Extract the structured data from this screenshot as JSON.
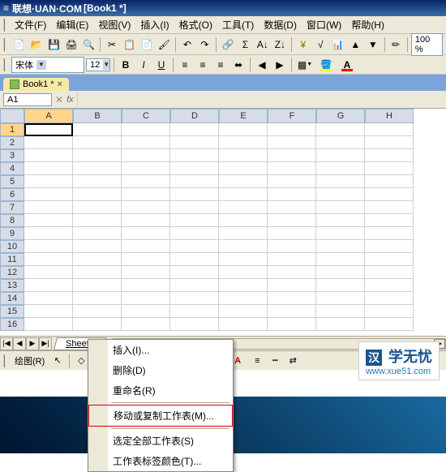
{
  "titlebar": {
    "app": "联想·UAN·COM",
    "doc": "[Book1 *]"
  },
  "menubar": {
    "items": [
      "文件(F)",
      "编辑(E)",
      "视图(V)",
      "插入(I)",
      "格式(O)",
      "工具(T)",
      "数据(D)",
      "窗口(W)",
      "帮助(H)"
    ]
  },
  "toolbar": {
    "zoom": "100 %"
  },
  "format": {
    "font_name": "宋体",
    "font_size": "12"
  },
  "tabs": {
    "doc_tab": "Book1 *"
  },
  "formula": {
    "namebox": "A1",
    "cancel": "✕",
    "fx": "fx"
  },
  "columns": [
    "A",
    "B",
    "C",
    "D",
    "E",
    "F",
    "G",
    "H"
  ],
  "rows": [
    "1",
    "2",
    "3",
    "4",
    "5",
    "6",
    "7",
    "8",
    "9",
    "10",
    "11",
    "12",
    "13",
    "14",
    "15",
    "16"
  ],
  "sheet": {
    "tab": "Sheet1"
  },
  "drawing": {
    "label": "绘图(R)"
  },
  "context_menu": {
    "items": [
      "插入(I)...",
      "删除(D)",
      "重命名(R)",
      "移动或复制工作表(M)...",
      "选定全部工作表(S)",
      "工作表标签颜色(T)..."
    ],
    "highlight_index": 3
  },
  "watermark": {
    "icon": "汉",
    "text": "学无忧",
    "url": "www.xue51.com"
  }
}
